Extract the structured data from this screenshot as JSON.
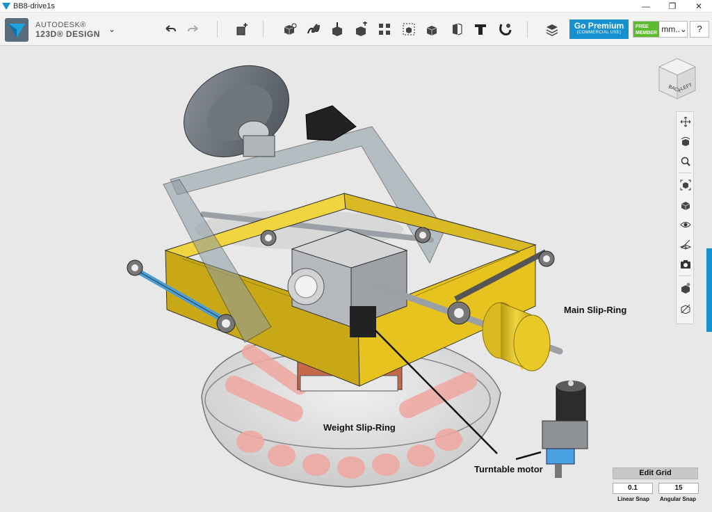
{
  "window": {
    "title": "BB8-drive1s",
    "minimize": "—",
    "maximize": "❐",
    "close": "✕"
  },
  "brand": {
    "line1": "AUTODESK®",
    "line2": "123D® DESIGN",
    "menu_glyph": "⌄"
  },
  "toolbar": {
    "icons": [
      "undo-icon",
      "redo-icon",
      "new-object-icon",
      "primitives-icon",
      "sketch-icon",
      "construct-icon",
      "modify-icon",
      "pattern-icon",
      "grouping-icon",
      "combine-icon",
      "snap-icon",
      "measure-icon",
      "text-icon",
      "material-icon",
      "layers-icon"
    ],
    "premium_title": "Go Premium",
    "premium_sub": "(COMMERCIAL USE)",
    "member_line1": "FREE",
    "member_line2": "MEMBER",
    "unit": "mm",
    "unit_suffix": "..⌄",
    "help": "?"
  },
  "viewcube": {
    "back": "BACK",
    "left": "LEFT"
  },
  "navbar": {
    "icons": [
      "pan-icon",
      "orbit-icon",
      "zoom-icon",
      "fit-icon",
      "views-icon",
      "visibility-icon",
      "grid-visibility-icon",
      "screenshot-icon",
      "material-toggle-icon",
      "outline-icon"
    ]
  },
  "callouts": {
    "main_slip_ring": "Main Slip-Ring",
    "weight_slip_ring": "Weight Slip-Ring",
    "turntable_motor": "Turntable motor"
  },
  "grid": {
    "edit_label": "Edit Grid",
    "linear_value": "0.1",
    "angular_value": "15",
    "linear_label": "Linear Snap",
    "angular_label": "Angular Snap"
  },
  "colors": {
    "accent": "#1790d0",
    "frame_yellow": "#e6c31e",
    "member_green": "#5dbb2f"
  }
}
